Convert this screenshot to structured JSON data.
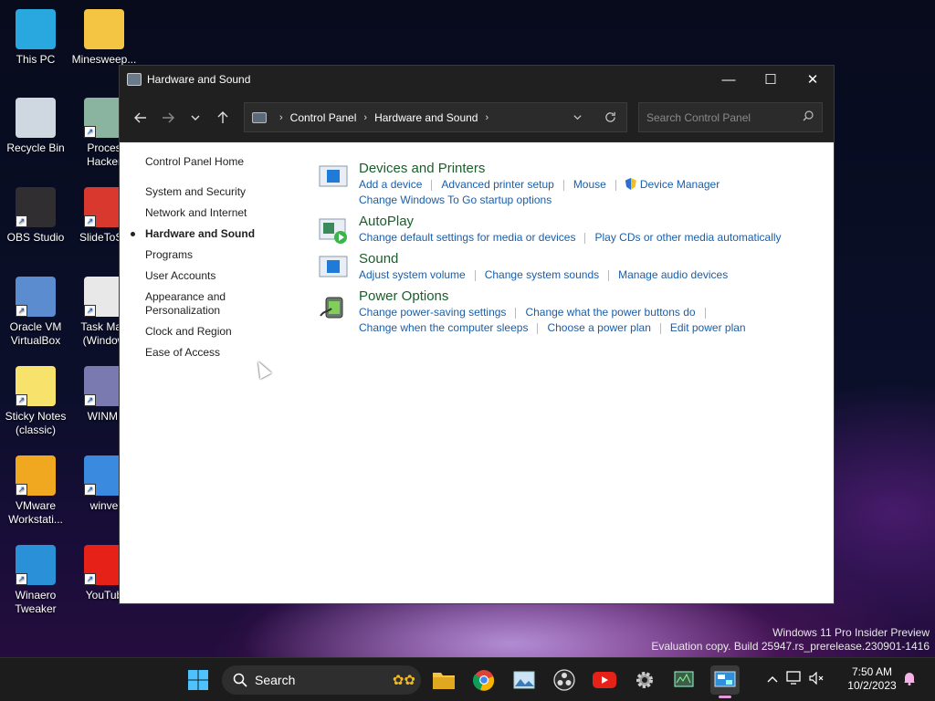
{
  "desktop": {
    "icons": [
      {
        "label": "This PC",
        "icon": "monitor-icon",
        "color": "#29a8e0"
      },
      {
        "label": "Minesweep...",
        "icon": "folder-icon",
        "color": "#f4c542"
      },
      {
        "label": "Recycle Bin",
        "icon": "recycle-bin-icon",
        "color": "#cfd8e0"
      },
      {
        "label": "Proces Hacker",
        "icon": "process-hacker-icon",
        "color": "#8ab4a0"
      },
      {
        "label": "OBS Studio",
        "icon": "obs-icon",
        "color": "#302e31"
      },
      {
        "label": "SlideToSh",
        "icon": "power-icon",
        "color": "#d9382f"
      },
      {
        "label": "Oracle VM VirtualBox",
        "icon": "virtualbox-icon",
        "color": "#5b8ccf"
      },
      {
        "label": "Task Man (Window",
        "icon": "file-icon",
        "color": "#e8e8e8"
      },
      {
        "label": "Sticky Notes (classic)",
        "icon": "sticky-notes-icon",
        "color": "#f7e36b"
      },
      {
        "label": "WINMI",
        "icon": "mine-icon",
        "color": "#7a7ab0"
      },
      {
        "label": "VMware Workstati...",
        "icon": "vmware-icon",
        "color": "#f0a820"
      },
      {
        "label": "winve",
        "icon": "winver-icon",
        "color": "#3a8ae0"
      },
      {
        "label": "Winaero Tweaker",
        "icon": "winaero-icon",
        "color": "#2a90d8"
      },
      {
        "label": "YouTub",
        "icon": "youtube-icon",
        "color": "#e62117"
      }
    ]
  },
  "window": {
    "title": "Hardware and Sound",
    "minimize": "—",
    "maximize": "☐",
    "close": "✕"
  },
  "address": {
    "crumbs": [
      "Control Panel",
      "Hardware and Sound"
    ],
    "search_placeholder": "Search Control Panel"
  },
  "leftnav": {
    "home": "Control Panel Home",
    "items": [
      {
        "label": "System and Security"
      },
      {
        "label": "Network and Internet"
      },
      {
        "label": "Hardware and Sound",
        "active": true
      },
      {
        "label": "Programs"
      },
      {
        "label": "User Accounts"
      },
      {
        "label": "Appearance and Personalization"
      },
      {
        "label": "Clock and Region"
      },
      {
        "label": "Ease of Access"
      }
    ]
  },
  "categories": [
    {
      "title": "Devices and Printers",
      "icon": "devices-printers-icon",
      "rows": [
        [
          "Add a device",
          "Advanced printer setup",
          "Mouse",
          "Device Manager"
        ],
        [
          "Change Windows To Go startup options"
        ]
      ]
    },
    {
      "title": "AutoPlay",
      "icon": "autoplay-icon",
      "rows": [
        [
          "Change default settings for media or devices",
          "Play CDs or other media automatically"
        ]
      ]
    },
    {
      "title": "Sound",
      "icon": "sound-icon",
      "rows": [
        [
          "Adjust system volume",
          "Change system sounds",
          "Manage audio devices"
        ]
      ]
    },
    {
      "title": "Power Options",
      "icon": "power-options-icon",
      "rows": [
        [
          "Change power-saving settings",
          "Change what the power buttons do"
        ],
        [
          "Change when the computer sleeps",
          "Choose a power plan",
          "Edit power plan"
        ]
      ]
    }
  ],
  "watermark": {
    "line1": "Windows 11 Pro Insider Preview",
    "line2": "Evaluation copy. Build 25947.rs_prerelease.230901-1416"
  },
  "taskbar": {
    "search_label": "Search",
    "time": "7:50 AM",
    "date": "10/2/2023"
  },
  "colors": {
    "link": "#1a5ea8",
    "category_title": "#1a5e2a",
    "chrome_dark": "#202020"
  }
}
